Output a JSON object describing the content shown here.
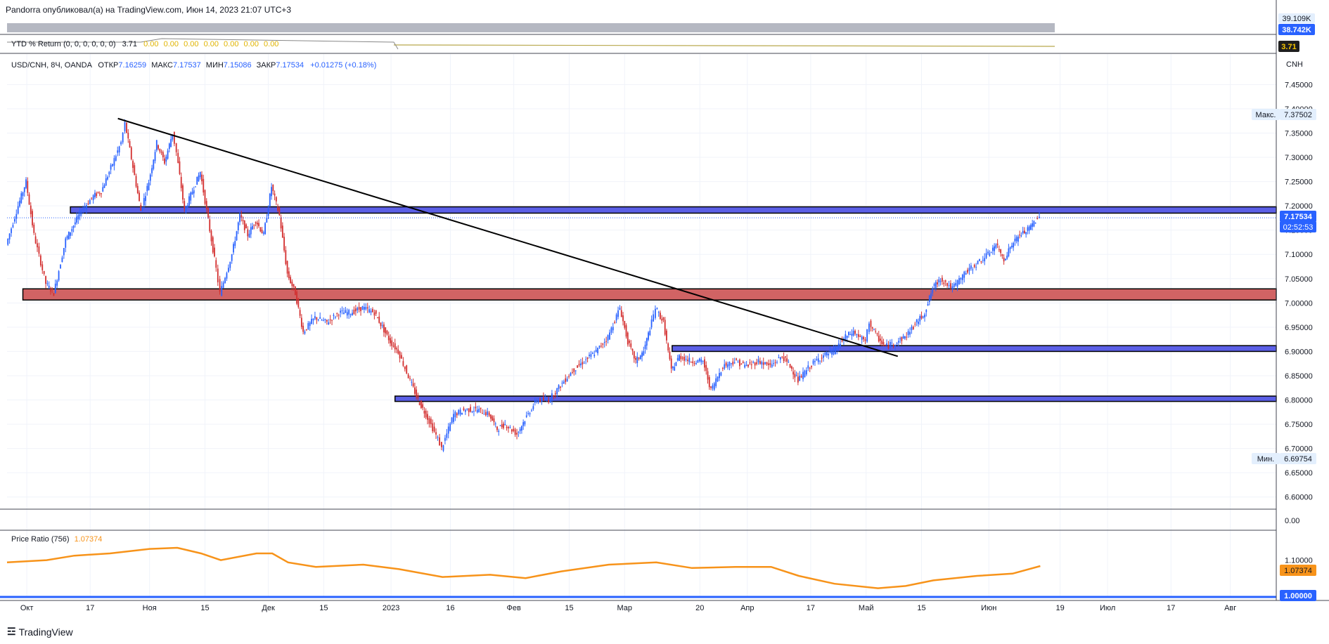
{
  "header": {
    "publish_line": "Pandorra опубликовал(а) на TradingView.com, Июн 14, 2023 21:07 UTC+3"
  },
  "top_pane": {
    "volume_badge": "38.742K",
    "volume_badge_partial": "39.109K",
    "ytd_title": "YTD % Return (0, 0, 0, 0, 0, 0)",
    "ytd_value": "3.71",
    "ytd_zero_values": [
      "0.00",
      "0.00",
      "0.00",
      "0.00",
      "0.00",
      "0.00",
      "0.00"
    ],
    "ytd_badge": "3.71"
  },
  "symbol": {
    "name": "USD/CNH, 8Ч, OANDA",
    "open_label": "ОТКР",
    "open": "7.16259",
    "high_label": "МАКС",
    "high": "7.17537",
    "low_label": "МИН",
    "low": "7.15086",
    "close_label": "ЗАКР",
    "close": "7.17534",
    "change": "+0.01275 (+0.18%)",
    "currency": "CNH"
  },
  "badges": {
    "max_label": "Макс.",
    "max_value": "7.37502",
    "min_label": "Мин.",
    "min_value": "6.69754",
    "last_price": "7.17534",
    "countdown": "02:52:53",
    "price_ratio_value": "1.07374",
    "price_ratio_base": "1.00000"
  },
  "price_ratio": {
    "title": "Price Ratio (756)",
    "value": "1.07374"
  },
  "footer": {
    "brand": "TradingView"
  },
  "colors": {
    "up": "#2962ff",
    "down": "#d32f2f",
    "ratio_line": "#f7931a",
    "zone_blue": "#5b5fe6",
    "zone_red": "#d16364",
    "bg": "#ffffff"
  },
  "chart_data": [
    {
      "type": "candlestick",
      "title": "USD/CNH, 8Ч, OANDA",
      "ylim": [
        6.575,
        7.465
      ],
      "y_ticks": [
        "7.45000",
        "7.40000",
        "7.35000",
        "7.30000",
        "7.25000",
        "7.20000",
        "7.15000",
        "7.10000",
        "7.05000",
        "7.00000",
        "6.95000",
        "6.90000",
        "6.85000",
        "6.80000",
        "6.75000",
        "6.70000",
        "6.65000",
        "6.60000",
        "0.00"
      ],
      "x_ticks": [
        "Окт",
        "17",
        "Ноя",
        "15",
        "Дек",
        "15",
        "2023",
        "16",
        "Фев",
        "15",
        "Мар",
        "20",
        "Апр",
        "17",
        "Май",
        "15",
        "Июн",
        "19",
        "Июл",
        "17",
        "Авг"
      ],
      "path_points": [
        {
          "date": "2022-09-26",
          "value": 7.12
        },
        {
          "date": "2022-09-29",
          "value": 7.2
        },
        {
          "date": "2022-10-01",
          "value": 7.25
        },
        {
          "date": "2022-10-03",
          "value": 7.14
        },
        {
          "date": "2022-10-06",
          "value": 7.04
        },
        {
          "date": "2022-10-08",
          "value": 7.02
        },
        {
          "date": "2022-10-11",
          "value": 7.13
        },
        {
          "date": "2022-10-13",
          "value": 7.16
        },
        {
          "date": "2022-10-15",
          "value": 7.19
        },
        {
          "date": "2022-10-18",
          "value": 7.22
        },
        {
          "date": "2022-10-20",
          "value": 7.23
        },
        {
          "date": "2022-10-22",
          "value": 7.27
        },
        {
          "date": "2022-10-25",
          "value": 7.33
        },
        {
          "date": "2022-10-26",
          "value": 7.37
        },
        {
          "date": "2022-10-28",
          "value": 7.28
        },
        {
          "date": "2022-10-30",
          "value": 7.19
        },
        {
          "date": "2022-11-01",
          "value": 7.25
        },
        {
          "date": "2022-11-03",
          "value": 7.33
        },
        {
          "date": "2022-11-05",
          "value": 7.29
        },
        {
          "date": "2022-11-07",
          "value": 7.35
        },
        {
          "date": "2022-11-08",
          "value": 7.31
        },
        {
          "date": "2022-11-10",
          "value": 7.19
        },
        {
          "date": "2022-11-12",
          "value": 7.23
        },
        {
          "date": "2022-11-14",
          "value": 7.27
        },
        {
          "date": "2022-11-16",
          "value": 7.17
        },
        {
          "date": "2022-11-18",
          "value": 7.07
        },
        {
          "date": "2022-11-19",
          "value": 7.02
        },
        {
          "date": "2022-11-22",
          "value": 7.1
        },
        {
          "date": "2022-11-24",
          "value": 7.18
        },
        {
          "date": "2022-11-26",
          "value": 7.14
        },
        {
          "date": "2022-11-28",
          "value": 7.17
        },
        {
          "date": "2022-11-30",
          "value": 7.14
        },
        {
          "date": "2022-12-02",
          "value": 7.24
        },
        {
          "date": "2022-12-04",
          "value": 7.18
        },
        {
          "date": "2022-12-06",
          "value": 7.06
        },
        {
          "date": "2022-12-08",
          "value": 7.02
        },
        {
          "date": "2022-12-10",
          "value": 6.94
        },
        {
          "date": "2022-12-13",
          "value": 6.97
        },
        {
          "date": "2022-12-16",
          "value": 6.96
        },
        {
          "date": "2022-12-19",
          "value": 6.98
        },
        {
          "date": "2022-12-22",
          "value": 6.98
        },
        {
          "date": "2022-12-25",
          "value": 6.99
        },
        {
          "date": "2022-12-28",
          "value": 6.98
        },
        {
          "date": "2022-12-30",
          "value": 6.95
        },
        {
          "date": "2023-01-01",
          "value": 6.92
        },
        {
          "date": "2023-01-03",
          "value": 6.9
        },
        {
          "date": "2023-01-06",
          "value": 6.84
        },
        {
          "date": "2023-01-08",
          "value": 6.8
        },
        {
          "date": "2023-01-10",
          "value": 6.77
        },
        {
          "date": "2023-01-13",
          "value": 6.72
        },
        {
          "date": "2023-01-14",
          "value": 6.7
        },
        {
          "date": "2023-01-17",
          "value": 6.77
        },
        {
          "date": "2023-01-20",
          "value": 6.78
        },
        {
          "date": "2023-01-23",
          "value": 6.78
        },
        {
          "date": "2023-01-26",
          "value": 6.77
        },
        {
          "date": "2023-01-28",
          "value": 6.74
        },
        {
          "date": "2023-01-30",
          "value": 6.75
        },
        {
          "date": "2023-02-02",
          "value": 6.73
        },
        {
          "date": "2023-02-04",
          "value": 6.76
        },
        {
          "date": "2023-02-07",
          "value": 6.8
        },
        {
          "date": "2023-02-10",
          "value": 6.8
        },
        {
          "date": "2023-02-13",
          "value": 6.83
        },
        {
          "date": "2023-02-16",
          "value": 6.86
        },
        {
          "date": "2023-02-19",
          "value": 6.88
        },
        {
          "date": "2023-02-22",
          "value": 6.9
        },
        {
          "date": "2023-02-25",
          "value": 6.93
        },
        {
          "date": "2023-02-28",
          "value": 6.99
        },
        {
          "date": "2023-03-02",
          "value": 6.92
        },
        {
          "date": "2023-03-04",
          "value": 6.88
        },
        {
          "date": "2023-03-06",
          "value": 6.9
        },
        {
          "date": "2023-03-08",
          "value": 6.96
        },
        {
          "date": "2023-03-09",
          "value": 6.99
        },
        {
          "date": "2023-03-11",
          "value": 6.96
        },
        {
          "date": "2023-03-13",
          "value": 6.86
        },
        {
          "date": "2023-03-15",
          "value": 6.89
        },
        {
          "date": "2023-03-18",
          "value": 6.88
        },
        {
          "date": "2023-03-21",
          "value": 6.88
        },
        {
          "date": "2023-03-23",
          "value": 6.82
        },
        {
          "date": "2023-03-26",
          "value": 6.87
        },
        {
          "date": "2023-03-29",
          "value": 6.88
        },
        {
          "date": "2023-04-01",
          "value": 6.87
        },
        {
          "date": "2023-04-04",
          "value": 6.88
        },
        {
          "date": "2023-04-07",
          "value": 6.87
        },
        {
          "date": "2023-04-10",
          "value": 6.89
        },
        {
          "date": "2023-04-12",
          "value": 6.87
        },
        {
          "date": "2023-04-14",
          "value": 6.84
        },
        {
          "date": "2023-04-17",
          "value": 6.87
        },
        {
          "date": "2023-04-20",
          "value": 6.89
        },
        {
          "date": "2023-04-23",
          "value": 6.9
        },
        {
          "date": "2023-04-26",
          "value": 6.93
        },
        {
          "date": "2023-04-28",
          "value": 6.94
        },
        {
          "date": "2023-05-01",
          "value": 6.92
        },
        {
          "date": "2023-05-02",
          "value": 6.96
        },
        {
          "date": "2023-05-04",
          "value": 6.93
        },
        {
          "date": "2023-05-06",
          "value": 6.91
        },
        {
          "date": "2023-05-09",
          "value": 6.92
        },
        {
          "date": "2023-05-11",
          "value": 6.93
        },
        {
          "date": "2023-05-14",
          "value": 6.96
        },
        {
          "date": "2023-05-16",
          "value": 6.98
        },
        {
          "date": "2023-05-18",
          "value": 7.03
        },
        {
          "date": "2023-05-20",
          "value": 7.05
        },
        {
          "date": "2023-05-23",
          "value": 7.03
        },
        {
          "date": "2023-05-26",
          "value": 7.06
        },
        {
          "date": "2023-05-29",
          "value": 7.08
        },
        {
          "date": "2023-06-01",
          "value": 7.1
        },
        {
          "date": "2023-06-03",
          "value": 7.12
        },
        {
          "date": "2023-06-05",
          "value": 7.09
        },
        {
          "date": "2023-06-07",
          "value": 7.12
        },
        {
          "date": "2023-06-09",
          "value": 7.14
        },
        {
          "date": "2023-06-11",
          "value": 7.15
        },
        {
          "date": "2023-06-13",
          "value": 7.17
        },
        {
          "date": "2023-06-14",
          "value": 7.175
        }
      ],
      "zones": [
        {
          "color": "blue",
          "from_date": "2022-10-12",
          "to_date": "2023-08-31",
          "low": 7.185,
          "high": 7.198
        },
        {
          "color": "red",
          "from_date": "2022-09-30",
          "to_date": "2023-08-31",
          "low": 7.006,
          "high": 7.029
        },
        {
          "color": "blue",
          "from_date": "2023-03-13",
          "to_date": "2023-08-31",
          "low": 6.9,
          "high": 6.912
        },
        {
          "color": "blue",
          "from_date": "2023-01-02",
          "to_date": "2023-08-31",
          "low": 6.797,
          "high": 6.808
        }
      ],
      "trendline": [
        {
          "date": "2022-10-24",
          "value": 7.38
        },
        {
          "date": "2023-05-09",
          "value": 6.89
        }
      ],
      "max": 7.37502,
      "min": 6.69754,
      "last": 7.17534
    },
    {
      "type": "line",
      "title": "Price Ratio (756)",
      "ylim": [
        0.93,
        1.23
      ],
      "y_ticks": [
        "1.10000"
      ],
      "base_value": 1.0,
      "series": [
        {
          "name": "Price Ratio (756)",
          "points": [
            {
              "date": "2022-09-26",
              "value": 1.09
            },
            {
              "date": "2022-10-06",
              "value": 1.1
            },
            {
              "date": "2022-10-13",
              "value": 1.12
            },
            {
              "date": "2022-10-22",
              "value": 1.13
            },
            {
              "date": "2022-11-01",
              "value": 1.15
            },
            {
              "date": "2022-11-08",
              "value": 1.155
            },
            {
              "date": "2022-11-14",
              "value": 1.13
            },
            {
              "date": "2022-11-19",
              "value": 1.1
            },
            {
              "date": "2022-11-28",
              "value": 1.13
            },
            {
              "date": "2022-12-02",
              "value": 1.13
            },
            {
              "date": "2022-12-06",
              "value": 1.09
            },
            {
              "date": "2022-12-13",
              "value": 1.07
            },
            {
              "date": "2022-12-25",
              "value": 1.08
            },
            {
              "date": "2023-01-03",
              "value": 1.06
            },
            {
              "date": "2023-01-14",
              "value": 1.025
            },
            {
              "date": "2023-01-26",
              "value": 1.035
            },
            {
              "date": "2023-02-04",
              "value": 1.02
            },
            {
              "date": "2023-02-13",
              "value": 1.05
            },
            {
              "date": "2023-02-25",
              "value": 1.08
            },
            {
              "date": "2023-03-09",
              "value": 1.09
            },
            {
              "date": "2023-03-18",
              "value": 1.065
            },
            {
              "date": "2023-03-29",
              "value": 1.07
            },
            {
              "date": "2023-04-07",
              "value": 1.07
            },
            {
              "date": "2023-04-14",
              "value": 1.03
            },
            {
              "date": "2023-04-23",
              "value": 0.995
            },
            {
              "date": "2023-05-04",
              "value": 0.975
            },
            {
              "date": "2023-05-11",
              "value": 0.985
            },
            {
              "date": "2023-05-18",
              "value": 1.01
            },
            {
              "date": "2023-05-29",
              "value": 1.03
            },
            {
              "date": "2023-06-07",
              "value": 1.04
            },
            {
              "date": "2023-06-14",
              "value": 1.0737
            }
          ]
        }
      ]
    }
  ]
}
